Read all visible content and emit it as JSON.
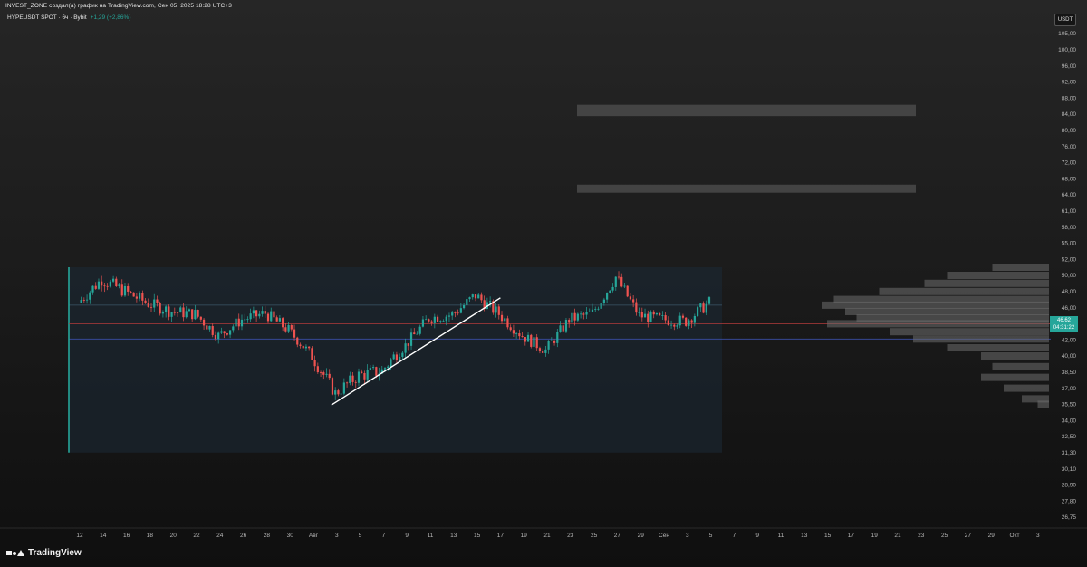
{
  "header": {
    "attribution": "INVEST_ZONE создал(а) график на TradingView.com, Сен 05, 2025 18:28 UTC+3",
    "symbol": "HYPEUSDT SPOT · 6ч · Bybit",
    "change": "+1,29 (+2,86%)",
    "currency": "USDT"
  },
  "brand": {
    "name": "TradingView"
  },
  "price_tags": {
    "last": "46,62",
    "countdown": "04:31:22"
  },
  "colors": {
    "up": "#26a69a",
    "down": "#ef5350",
    "trendline": "#ffffff",
    "range_box": "#1b2a36"
  },
  "chart_data": {
    "type": "candlestick",
    "title": "HYPEUSDT SPOT · 6ч · Bybit",
    "y_axis_labels": [
      "105,00",
      "100,00",
      "96,00",
      "92,00",
      "88,00",
      "84,00",
      "80,00",
      "76,00",
      "72,00",
      "68,00",
      "64,00",
      "61,00",
      "58,00",
      "55,00",
      "52,00",
      "50,00",
      "48,00",
      "46,00",
      "44,00",
      "42,00",
      "40,00",
      "38,50",
      "37,00",
      "35,50",
      "34,00",
      "32,50",
      "31,30",
      "30,10",
      "28,90",
      "27,80",
      "26,75"
    ],
    "x_axis_labels": [
      "12",
      "14",
      "16",
      "18",
      "20",
      "22",
      "24",
      "26",
      "28",
      "30",
      "Авг",
      "3",
      "5",
      "7",
      "9",
      "11",
      "13",
      "15",
      "17",
      "19",
      "21",
      "23",
      "25",
      "27",
      "29",
      "Сен",
      "3",
      "5",
      "7",
      "9",
      "11",
      "13",
      "15",
      "17",
      "19",
      "21",
      "23",
      "25",
      "27",
      "29",
      "Окт",
      "3"
    ],
    "scale": "log",
    "ylim": [
      26.0,
      108.0
    ],
    "close_anchors": [
      {
        "label": "12",
        "close": 46.6
      },
      {
        "label": "14",
        "close": 49.5
      },
      {
        "label": "16",
        "close": 48.0
      },
      {
        "label": "18",
        "close": 46.5
      },
      {
        "label": "20",
        "close": 45.5
      },
      {
        "label": "22",
        "close": 45.2
      },
      {
        "label": "24",
        "close": 42.5
      },
      {
        "label": "26",
        "close": 44.5
      },
      {
        "label": "28",
        "close": 45.3
      },
      {
        "label": "30",
        "close": 43.2
      },
      {
        "label": "Авг",
        "close": 40.0
      },
      {
        "label": "3",
        "close": 36.5
      },
      {
        "label": "5",
        "close": 38.2
      },
      {
        "label": "7",
        "close": 38.6
      },
      {
        "label": "9",
        "close": 41.3
      },
      {
        "label": "11",
        "close": 44.7
      },
      {
        "label": "13",
        "close": 45.1
      },
      {
        "label": "15",
        "close": 47.5
      },
      {
        "label": "17",
        "close": 45.2
      },
      {
        "label": "19",
        "close": 42.5
      },
      {
        "label": "21",
        "close": 40.7
      },
      {
        "label": "23",
        "close": 44.5
      },
      {
        "label": "25",
        "close": 45.3
      },
      {
        "label": "27",
        "close": 49.8
      },
      {
        "label": "29",
        "close": 45.0
      },
      {
        "label": "Сен",
        "close": 44.5
      },
      {
        "label": "3",
        "close": 44.3
      },
      {
        "label": "5",
        "close": 46.6
      }
    ],
    "range_box": {
      "top": 51.0,
      "bottom": 31.3,
      "mid_line": 46.3,
      "upper_band": 46.3,
      "lower_band": 42.1
    },
    "red_line": 44.0,
    "resistance_zones": [
      {
        "from": 83.5,
        "to": 86.3
      },
      {
        "from": 64.5,
        "to": 66.5
      }
    ],
    "trendline": {
      "start": {
        "label": "3",
        "price": 35.6
      },
      "end": {
        "label": "17",
        "price": 47.2
      }
    },
    "volume_profile": [
      {
        "price": 51.0,
        "volume": 0.25
      },
      {
        "price": 50.0,
        "volume": 0.45
      },
      {
        "price": 49.0,
        "volume": 0.55
      },
      {
        "price": 48.0,
        "volume": 0.75
      },
      {
        "price": 47.0,
        "volume": 0.95
      },
      {
        "price": 46.3,
        "volume": 1.0
      },
      {
        "price": 45.5,
        "volume": 0.9
      },
      {
        "price": 44.7,
        "volume": 0.85
      },
      {
        "price": 44.0,
        "volume": 0.98
      },
      {
        "price": 43.0,
        "volume": 0.7
      },
      {
        "price": 42.1,
        "volume": 0.6
      },
      {
        "price": 41.0,
        "volume": 0.45
      },
      {
        "price": 40.0,
        "volume": 0.3
      },
      {
        "price": 39.0,
        "volume": 0.25
      },
      {
        "price": 38.0,
        "volume": 0.3
      },
      {
        "price": 37.0,
        "volume": 0.2
      },
      {
        "price": 36.0,
        "volume": 0.12
      },
      {
        "price": 35.5,
        "volume": 0.05
      }
    ]
  }
}
